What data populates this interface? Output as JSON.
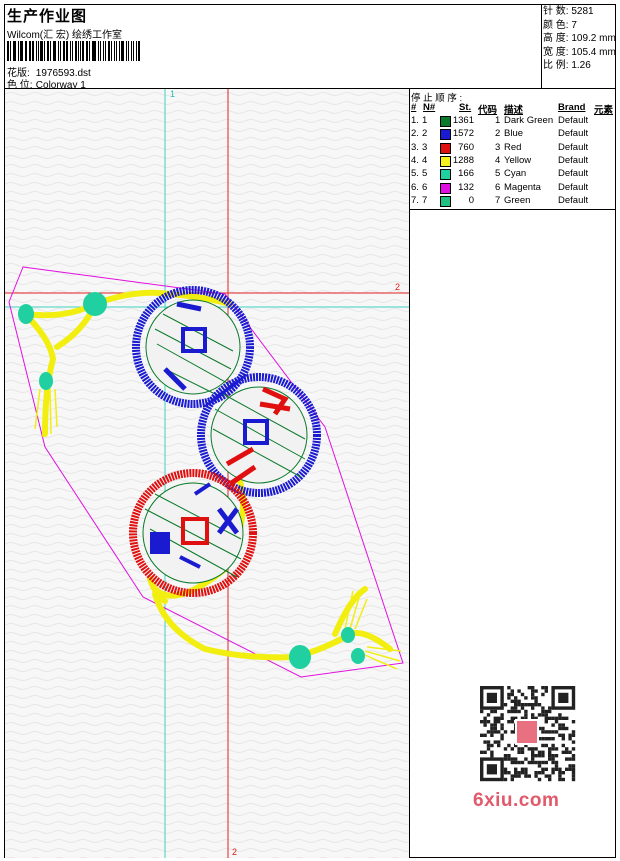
{
  "header": {
    "title": "生产作业图",
    "company": "Wilcom(汇 宏) 绘绣工作室",
    "design_label": "花版:",
    "design_value": "1976593.dst",
    "colorway_label": "色 位:",
    "colorway_value": "Colorway 1"
  },
  "stats": [
    {
      "label": "针 数:",
      "value": "5281"
    },
    {
      "label": "颜 色:",
      "value": "7"
    },
    {
      "label": "高 度:",
      "value": "109.2 mm"
    },
    {
      "label": "宽 度:",
      "value": "105.4 mm"
    },
    {
      "label": "比 例:",
      "value": "1.26"
    }
  ],
  "canvas": {
    "guide_top_label": "1",
    "guide_right_label": "2",
    "guide_bottom_label": "2"
  },
  "stop_sequence": {
    "title": "停 止 顺 序 :",
    "columns": [
      "#",
      "N#",
      "St.",
      "代码",
      "描述",
      "Brand",
      "元素"
    ],
    "rows": [
      {
        "num": "1.",
        "n": "1",
        "st": "1361",
        "code": "1",
        "desc": "Dark Green",
        "brand": "Default",
        "color": "#0a7a2a"
      },
      {
        "num": "2.",
        "n": "2",
        "st": "1572",
        "code": "2",
        "desc": "Blue",
        "brand": "Default",
        "color": "#1a1ad0"
      },
      {
        "num": "3.",
        "n": "3",
        "st": "760",
        "code": "3",
        "desc": "Red",
        "brand": "Default",
        "color": "#e01010"
      },
      {
        "num": "4.",
        "n": "4",
        "st": "1288",
        "code": "4",
        "desc": "Yellow",
        "brand": "Default",
        "color": "#f5f020"
      },
      {
        "num": "5.",
        "n": "5",
        "st": "166",
        "code": "5",
        "desc": "Cyan",
        "brand": "Default",
        "color": "#20d0a0"
      },
      {
        "num": "6.",
        "n": "6",
        "st": "132",
        "code": "6",
        "desc": "Magenta",
        "brand": "Default",
        "color": "#e010e0"
      },
      {
        "num": "7.",
        "n": "7",
        "st": "0",
        "code": "7",
        "desc": "Green",
        "brand": "Default",
        "color": "#20c080"
      }
    ]
  },
  "watermark": {
    "text": "6xiu.com"
  }
}
